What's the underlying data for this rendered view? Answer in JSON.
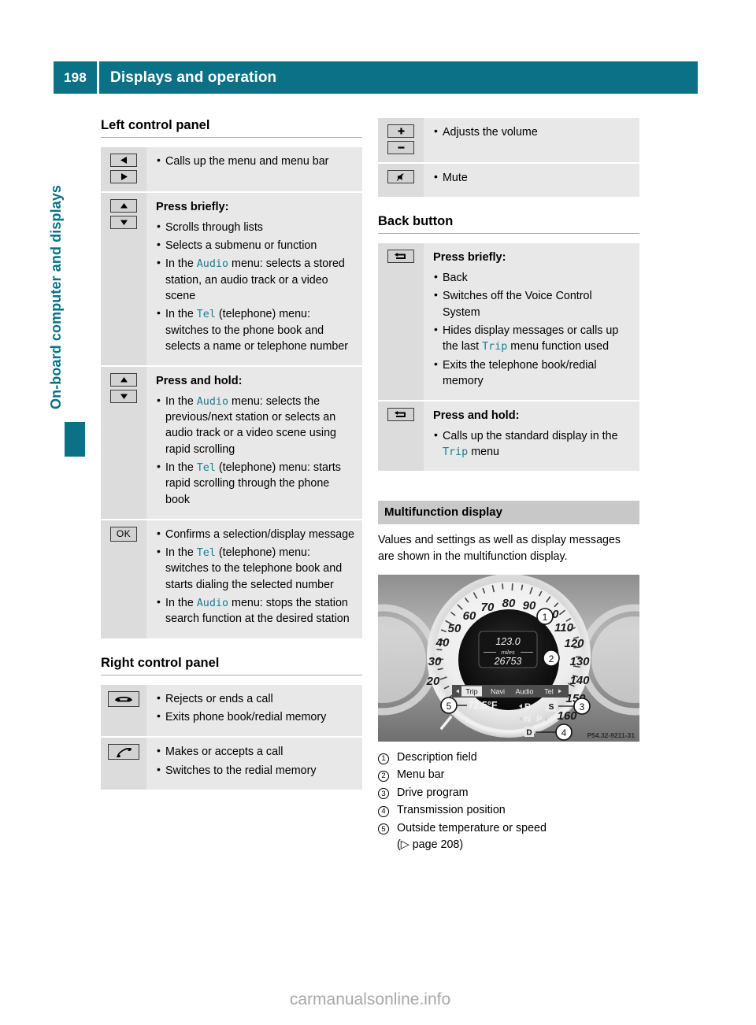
{
  "header": {
    "page_number": "198",
    "title": "Displays and operation"
  },
  "side_tab": {
    "label": "On-board computer and displays"
  },
  "left_column": {
    "section_title": "Left control panel",
    "rows": [
      {
        "icons": [
          "arrow-left-button",
          "arrow-right-button"
        ],
        "heading": "",
        "items": [
          {
            "parts": [
              {
                "t": "Calls up the menu and menu bar"
              }
            ]
          }
        ]
      },
      {
        "icons": [
          "arrow-up-button",
          "arrow-down-button"
        ],
        "heading": "Press briefly:",
        "items": [
          {
            "parts": [
              {
                "t": "Scrolls through lists"
              }
            ]
          },
          {
            "parts": [
              {
                "t": "Selects a submenu or function"
              }
            ]
          },
          {
            "parts": [
              {
                "t": "In the "
              },
              {
                "t": "Audio",
                "kw": true
              },
              {
                "t": " menu: selects a stored station, an audio track or a video scene"
              }
            ]
          },
          {
            "parts": [
              {
                "t": "In the "
              },
              {
                "t": "Tel",
                "kw": true
              },
              {
                "t": " (telephone) menu: switches to the phone book and selects a name or telephone number"
              }
            ]
          }
        ]
      },
      {
        "icons": [
          "arrow-up-button",
          "arrow-down-button"
        ],
        "heading": "Press and hold:",
        "items": [
          {
            "parts": [
              {
                "t": "In the "
              },
              {
                "t": "Audio",
                "kw": true
              },
              {
                "t": " menu: selects the previous/next station or selects an audio track or a video scene using rapid scrolling"
              }
            ]
          },
          {
            "parts": [
              {
                "t": "In the "
              },
              {
                "t": "Tel",
                "kw": true
              },
              {
                "t": " (telephone) menu: starts rapid scrolling through the phone book"
              }
            ]
          }
        ]
      },
      {
        "icons": [
          "ok-button"
        ],
        "heading": "",
        "items": [
          {
            "parts": [
              {
                "t": "Confirms a selection/display message"
              }
            ]
          },
          {
            "parts": [
              {
                "t": "In the "
              },
              {
                "t": "Tel",
                "kw": true
              },
              {
                "t": " (telephone) menu: switches to the telephone book and starts dialing the selected number"
              }
            ]
          },
          {
            "parts": [
              {
                "t": "In the "
              },
              {
                "t": "Audio",
                "kw": true
              },
              {
                "t": " menu: stops the station search function at the desired station"
              }
            ]
          }
        ]
      }
    ],
    "section_title_2": "Right control panel",
    "rows_2": [
      {
        "icons": [
          "end-call-button"
        ],
        "heading": "",
        "items": [
          {
            "parts": [
              {
                "t": "Rejects or ends a call"
              }
            ]
          },
          {
            "parts": [
              {
                "t": "Exits phone book/redial memory"
              }
            ]
          }
        ]
      },
      {
        "icons": [
          "call-button"
        ],
        "heading": "",
        "items": [
          {
            "parts": [
              {
                "t": "Makes or accepts a call"
              }
            ]
          },
          {
            "parts": [
              {
                "t": "Switches to the redial memory"
              }
            ]
          }
        ]
      }
    ]
  },
  "right_column": {
    "rows_top": [
      {
        "icons": [
          "volume-up-button",
          "volume-down-button"
        ],
        "heading": "",
        "items": [
          {
            "parts": [
              {
                "t": "Adjusts the volume"
              }
            ]
          }
        ]
      },
      {
        "icons": [
          "mute-button"
        ],
        "heading": "",
        "items": [
          {
            "parts": [
              {
                "t": "Mute"
              }
            ]
          }
        ]
      }
    ],
    "section_title": "Back button",
    "rows_back": [
      {
        "icons": [
          "back-button"
        ],
        "heading": "Press briefly:",
        "items": [
          {
            "parts": [
              {
                "t": "Back"
              }
            ]
          },
          {
            "parts": [
              {
                "t": "Switches off the Voice Control System"
              }
            ]
          },
          {
            "parts": [
              {
                "t": "Hides display messages or calls up the last "
              },
              {
                "t": "Trip",
                "kw": true
              },
              {
                "t": " menu function used"
              }
            ]
          },
          {
            "parts": [
              {
                "t": "Exits the telephone book/redial memory"
              }
            ]
          }
        ]
      },
      {
        "icons": [
          "back-button"
        ],
        "heading": "Press and hold:",
        "items": [
          {
            "parts": [
              {
                "t": "Calls up the standard display in the "
              },
              {
                "t": "Trip",
                "kw": true
              },
              {
                "t": " menu"
              }
            ]
          }
        ]
      }
    ],
    "banner": "Multifunction display",
    "paragraph": "Values and settings as well as display messages are shown in the multifunction display.",
    "figure": {
      "name": "instrument-cluster-photo",
      "speedometer_ticks": [
        "20",
        "30",
        "40",
        "50",
        "60",
        "70",
        "80",
        "90",
        "100",
        "110",
        "120",
        "130",
        "140",
        "150",
        "160"
      ],
      "display_value": "123.0",
      "display_unit": "miles",
      "odometer": "26753",
      "menu_bar": [
        "Trip",
        "Navi",
        "Audio",
        "Tel"
      ],
      "menu_selected": "Trip",
      "temperature": "72.5°F",
      "drive_program": "S",
      "transmission_positions": [
        "R",
        "N",
        "P",
        "D"
      ],
      "transmission_selected": "D",
      "part_number": "P54.32-9211-31",
      "callouts": [
        "1",
        "2",
        "3",
        "4",
        "5"
      ]
    },
    "legend": [
      {
        "num": "1",
        "text": "Description field",
        "sub": ""
      },
      {
        "num": "2",
        "text": "Menu bar",
        "sub": ""
      },
      {
        "num": "3",
        "text": "Drive program",
        "sub": ""
      },
      {
        "num": "4",
        "text": "Transmission position",
        "sub": ""
      },
      {
        "num": "5",
        "text": "Outside temperature or speed",
        "sub": "(▷ page 208)"
      }
    ]
  },
  "watermark": "carmanualsonline.info",
  "colors": {
    "brand_teal": "#0a7186",
    "keyword_blue": "#1a7e96",
    "row_body_bg": "#e8e8e8",
    "row_key_bg": "#dcdcdc",
    "banner_bg": "#c8c8c8"
  }
}
